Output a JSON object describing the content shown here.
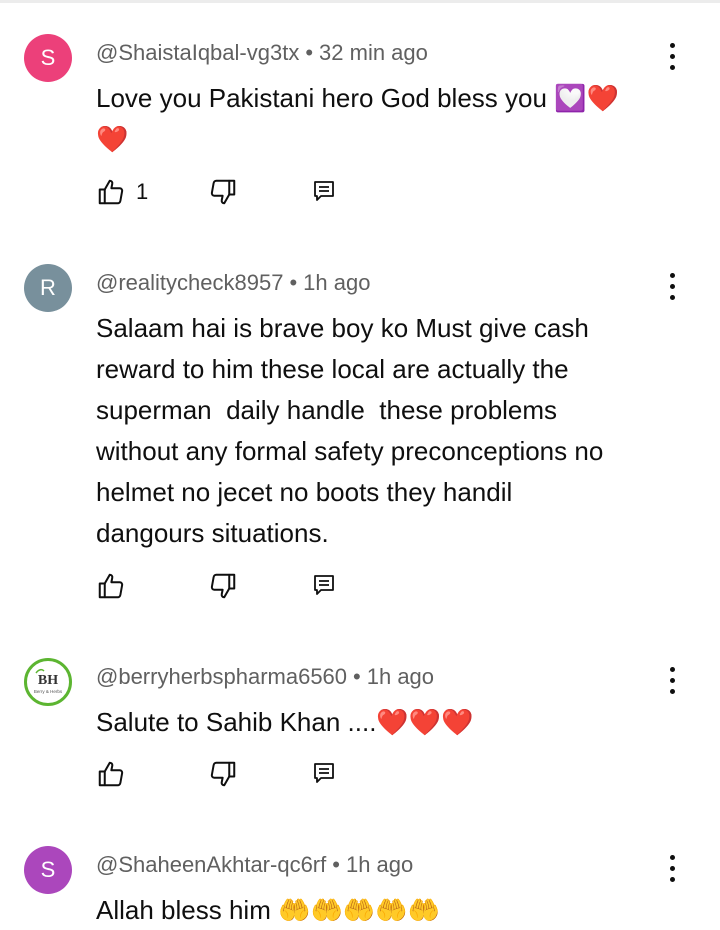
{
  "comments": [
    {
      "avatar_letter": "S",
      "avatar_color": "#ec407a",
      "author": "@ShaistaIqbal-vg3tx",
      "time": "32 min ago",
      "text": "Love you Pakistani hero God bless you 💟❤️\n❤️",
      "likes": "1"
    },
    {
      "avatar_letter": "R",
      "avatar_color": "#78909c",
      "author": "@realitycheck8957",
      "time": "1h ago",
      "text": "Salaam hai is brave boy ko Must give cash\nreward to him these local are actually the\nsuperman  daily handle  these problems\nwithout any formal safety preconceptions no\nhelmet no jecet no boots they handil\ndangours situations.",
      "likes": ""
    },
    {
      "avatar_logo": "BH",
      "avatar_logo_caption": "Berry & Herbs",
      "author": "@berryherbspharma6560",
      "time": "1h ago",
      "text": "Salute to Sahib Khan ....❤️❤️❤️",
      "likes": ""
    },
    {
      "avatar_letter": "S",
      "avatar_color": "#ab47bc",
      "author": "@ShaheenAkhtar-qc6rf",
      "time": "1h ago",
      "text": "Allah bless him 🤲🤲🤲🤲🤲",
      "likes": ""
    }
  ],
  "separator": "•",
  "icons": {
    "like": "thumb-up-icon",
    "dislike": "thumb-down-icon",
    "reply": "reply-comment-icon",
    "menu": "more-vert-icon"
  }
}
